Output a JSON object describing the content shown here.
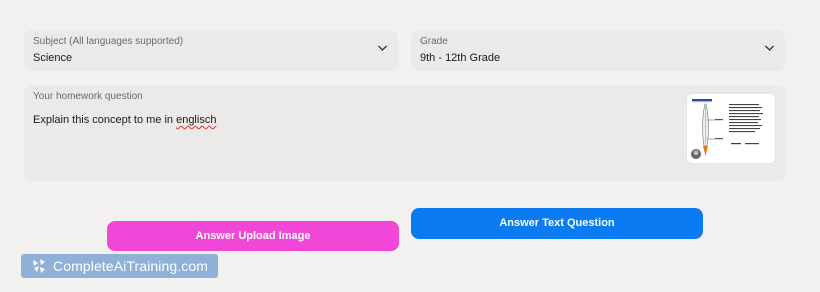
{
  "subject": {
    "label": "Subject (All languages supported)",
    "value": "Science",
    "icon": "chevron-down-icon"
  },
  "grade": {
    "label": "Grade",
    "value": "9th - 12th Grade",
    "icon": "chevron-down-icon"
  },
  "question": {
    "label": "Your homework question",
    "text_before": "Explain this concept to me in ",
    "text_misspelled": "englisch"
  },
  "attachment": {
    "icon": "remove-icon"
  },
  "buttons": {
    "upload_label": "Answer Upload Image",
    "text_label": "Answer Text Question"
  },
  "watermark": {
    "text": "CompleteAiTraining.com",
    "icon": "logo-icon"
  },
  "colors": {
    "upload_button": "#f047d8",
    "text_button": "#0a7bf0",
    "watermark_bg": "#8fb1d8",
    "background": "#f2f1ef",
    "field_bg": "#ebeae8"
  }
}
